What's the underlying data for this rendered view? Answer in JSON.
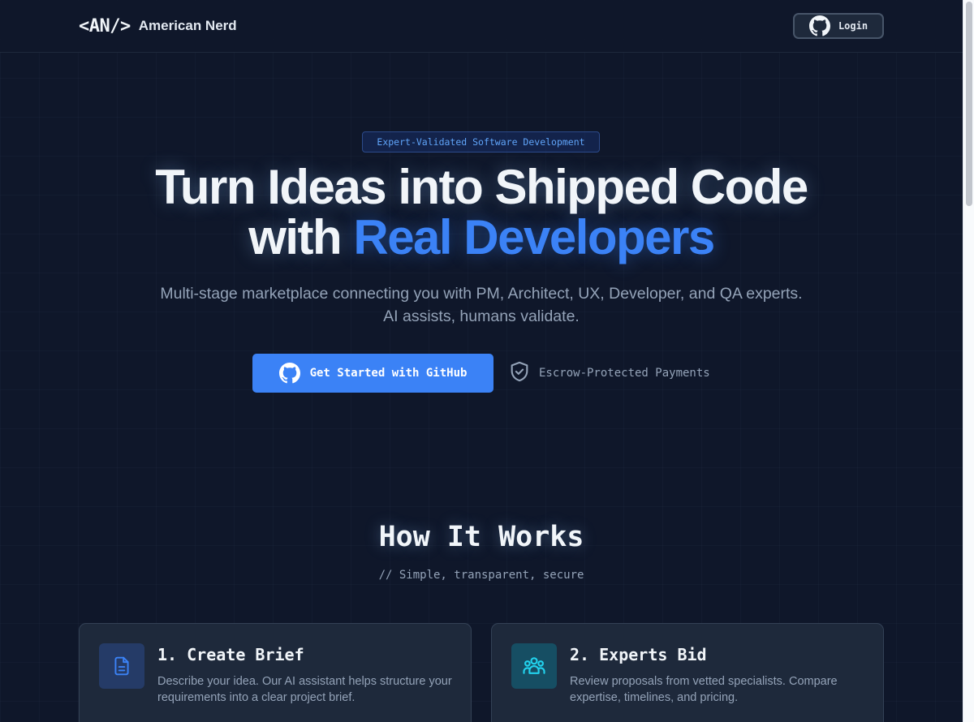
{
  "header": {
    "logo_mark": "<AN/>",
    "logo_text": "American Nerd",
    "login_label": "Login"
  },
  "hero": {
    "badge": "Expert-Validated Software Development",
    "title_line1": "Turn Ideas into Shipped Code",
    "title_line2_prefix": "with ",
    "title_line2_accent": "Real Developers",
    "subtitle": "Multi-stage marketplace connecting you with PM, Architect, UX, Developer, and QA experts. AI assists, humans validate.",
    "cta_label": "Get Started with GitHub",
    "escrow_label": "Escrow-Protected Payments"
  },
  "how_it_works": {
    "title": "How It Works",
    "subtitle": "// Simple, transparent, secure",
    "cards": [
      {
        "title": "1. Create Brief",
        "description": "Describe your idea. Our AI assistant helps structure your requirements into a clear project brief.",
        "icon": "document-icon"
      },
      {
        "title": "2. Experts Bid",
        "description": "Review proposals from vetted specialists. Compare expertise, timelines, and pricing.",
        "icon": "users-icon"
      }
    ]
  },
  "colors": {
    "background": "#0f172a",
    "accent": "#3b82f6",
    "card": "#1e293b",
    "muted_text": "#94a3b8"
  }
}
